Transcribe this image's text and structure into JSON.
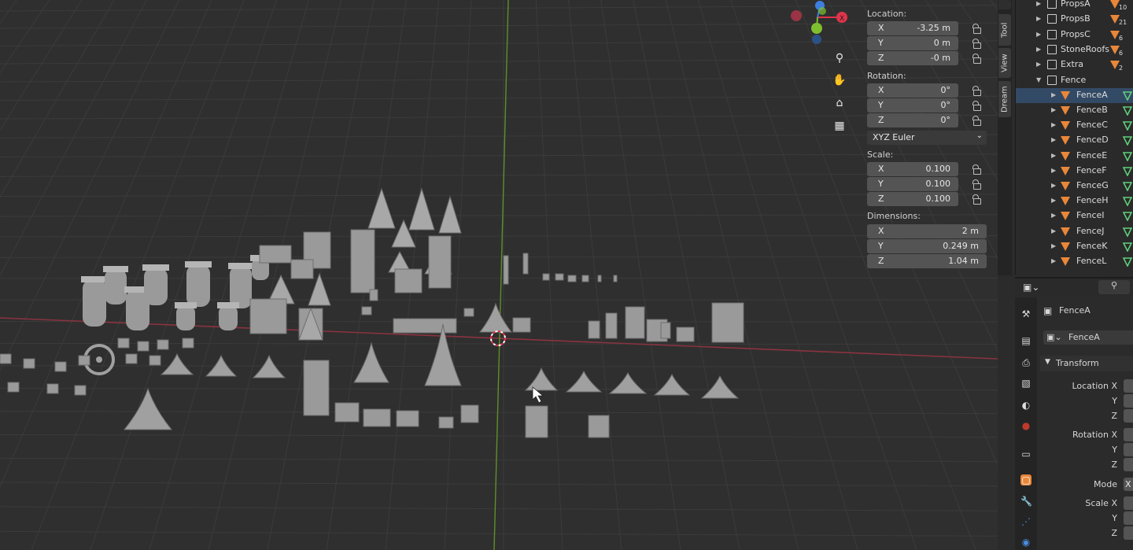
{
  "npanel": {
    "location_label": "Location:",
    "location": [
      {
        "axis": "X",
        "value": "-3.25 m"
      },
      {
        "axis": "Y",
        "value": "0 m"
      },
      {
        "axis": "Z",
        "value": "-0 m"
      }
    ],
    "rotation_label": "Rotation:",
    "rotation": [
      {
        "axis": "X",
        "value": "0°"
      },
      {
        "axis": "Y",
        "value": "0°"
      },
      {
        "axis": "Z",
        "value": "0°"
      }
    ],
    "rotation_mode": "XYZ Euler",
    "scale_label": "Scale:",
    "scale": [
      {
        "axis": "X",
        "value": "0.100"
      },
      {
        "axis": "Y",
        "value": "0.100"
      },
      {
        "axis": "Z",
        "value": "0.100"
      }
    ],
    "dimensions_label": "Dimensions:",
    "dimensions": [
      {
        "axis": "X",
        "value": "2 m"
      },
      {
        "axis": "Y",
        "value": "0.249 m"
      },
      {
        "axis": "Z",
        "value": "1.04 m"
      }
    ]
  },
  "vtabs": [
    "Tool",
    "View",
    "Dream"
  ],
  "outliner": {
    "collections": [
      {
        "label": "PropsA",
        "count": "10"
      },
      {
        "label": "PropsB",
        "count": "21"
      },
      {
        "label": "PropsC",
        "count": "6"
      },
      {
        "label": "StoneRoofs",
        "count": "6"
      },
      {
        "label": "Extra",
        "count": "2"
      },
      {
        "label": "Fence",
        "count": ""
      }
    ],
    "objects": [
      "FenceA",
      "FenceB",
      "FenceC",
      "FenceD",
      "FenceE",
      "FenceF",
      "FenceG",
      "FenceH",
      "FenceI",
      "FenceJ",
      "FenceK",
      "FenceL"
    ]
  },
  "properties": {
    "object_name": "FenceA",
    "datablock_name": "FenceA",
    "transform_label": "Transform",
    "location_x": "Location X",
    "rotation_x": "Rotation X",
    "mode_label": "Mode",
    "mode_value": "X",
    "scale_x": "Scale X",
    "y": "Y",
    "z": "Z"
  },
  "colors": {
    "accent": "#e8873a",
    "x_axis": "#e0344a",
    "y_axis": "#7fbf2f",
    "z_axis": "#3d7ee0"
  }
}
